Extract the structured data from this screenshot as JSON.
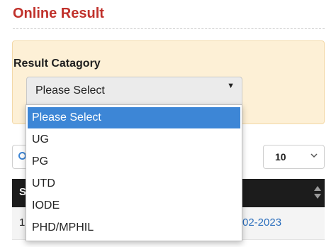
{
  "header": {
    "title": "Online Result"
  },
  "filter": {
    "label": "Result Catagory",
    "selected_value": "Please Select",
    "options": [
      "Please Select",
      "UG",
      "PG",
      "UTD",
      "IODE",
      "PHD/MPHIL"
    ],
    "highlighted_index": 0
  },
  "table_controls": {
    "page_length": "10"
  },
  "table": {
    "header_first_col": "S",
    "rows": [
      {
        "num": "1",
        "link_text": "02-2023"
      }
    ]
  },
  "colors": {
    "title": "#c0312b",
    "panel_bg": "#fdf0d6",
    "option_highlight": "#3d86d6",
    "table_header_bg": "#1c1c1c",
    "link": "#2a6ebd"
  },
  "icons": [
    "dropdown-caret-icon",
    "search-icon",
    "chevron-down-icon",
    "sort-icon"
  ]
}
